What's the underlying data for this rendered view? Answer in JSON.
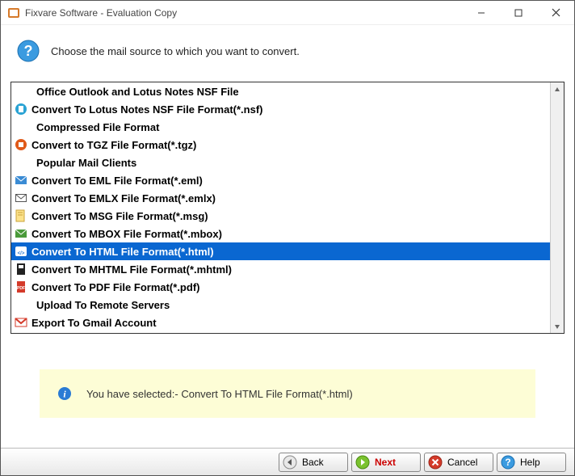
{
  "window": {
    "title": "Fixvare Software - Evaluation Copy"
  },
  "header": {
    "text": "Choose the mail source to which you want to convert."
  },
  "list": {
    "items": [
      {
        "type": "header",
        "label": "Office Outlook and Lotus Notes NSF File"
      },
      {
        "type": "item",
        "icon": "nsf",
        "label": "Convert To Lotus Notes NSF File Format(*.nsf)"
      },
      {
        "type": "header",
        "label": "Compressed File Format"
      },
      {
        "type": "item",
        "icon": "tgz",
        "label": "Convert to TGZ File Format(*.tgz)"
      },
      {
        "type": "header",
        "label": "Popular Mail Clients"
      },
      {
        "type": "item",
        "icon": "eml",
        "label": "Convert To EML File Format(*.eml)"
      },
      {
        "type": "item",
        "icon": "emlx",
        "label": "Convert To EMLX File Format(*.emlx)"
      },
      {
        "type": "item",
        "icon": "msg",
        "label": "Convert To MSG File Format(*.msg)"
      },
      {
        "type": "item",
        "icon": "mbox",
        "label": "Convert To MBOX File Format(*.mbox)"
      },
      {
        "type": "item",
        "icon": "html",
        "label": "Convert To HTML File Format(*.html)",
        "selected": true
      },
      {
        "type": "item",
        "icon": "mhtml",
        "label": "Convert To MHTML File Format(*.mhtml)"
      },
      {
        "type": "item",
        "icon": "pdf",
        "label": "Convert To PDF File Format(*.pdf)"
      },
      {
        "type": "header",
        "label": "Upload To Remote Servers"
      },
      {
        "type": "item",
        "icon": "gmail",
        "label": "Export To Gmail Account"
      }
    ]
  },
  "info": {
    "message": "You have selected:- Convert To HTML File Format(*.html)"
  },
  "footer": {
    "back": "Back",
    "next": "Next",
    "cancel": "Cancel",
    "help": "Help"
  }
}
